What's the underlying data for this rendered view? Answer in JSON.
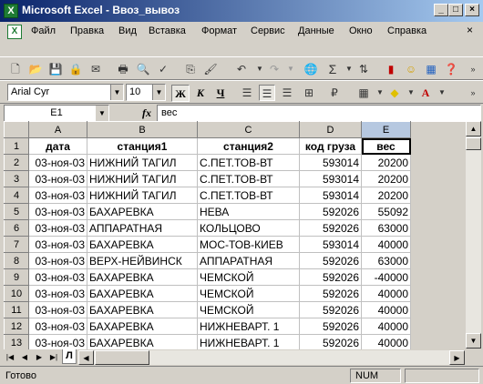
{
  "window": {
    "title": "Microsoft Excel - Ввоз_вывоз"
  },
  "menu": [
    "Файл",
    "Правка",
    "Вид",
    "Вставка",
    "Формат",
    "Сервис",
    "Данные",
    "Окно",
    "Справка"
  ],
  "format_toolbar": {
    "font": "Arial Cyr",
    "size": "10",
    "bold": "Ж",
    "italic": "К",
    "underline": "Ч"
  },
  "formula_bar": {
    "cell_ref": "E1",
    "fx": "fx",
    "content": "вес"
  },
  "sheet": {
    "columns": [
      "A",
      "B",
      "C",
      "D",
      "E"
    ],
    "rows": [
      [
        "1",
        "дата",
        "станция1",
        "станция2",
        "код груза",
        "вес"
      ],
      [
        "2",
        "03-ноя-03",
        "НИЖНИЙ ТАГИЛ",
        "С.ПЕТ.ТОВ-ВТ",
        "593014",
        "20200"
      ],
      [
        "3",
        "03-ноя-03",
        "НИЖНИЙ ТАГИЛ",
        "С.ПЕТ.ТОВ-ВТ",
        "593014",
        "20200"
      ],
      [
        "4",
        "03-ноя-03",
        "НИЖНИЙ ТАГИЛ",
        "С.ПЕТ.ТОВ-ВТ",
        "593014",
        "20200"
      ],
      [
        "5",
        "03-ноя-03",
        "БАХАРЕВКА",
        "НЕВА",
        "592026",
        "55092"
      ],
      [
        "6",
        "03-ноя-03",
        "АППАРАТНАЯ",
        "КОЛЬЦОВО",
        "592026",
        "63000"
      ],
      [
        "7",
        "03-ноя-03",
        "БАХАРЕВКА",
        "МОС-ТОВ-КИЕВ",
        "593014",
        "40000"
      ],
      [
        "8",
        "03-ноя-03",
        "ВЕРХ-НЕЙВИНСК",
        "АППАРАТНАЯ",
        "592026",
        "63000"
      ],
      [
        "9",
        "03-ноя-03",
        "БАХАРЕВКА",
        "ЧЕМСКОЙ",
        "592026",
        "-40000"
      ],
      [
        "10",
        "03-ноя-03",
        "БАХАРЕВКА",
        "ЧЕМСКОЙ",
        "592026",
        "40000"
      ],
      [
        "11",
        "03-ноя-03",
        "БАХАРЕВКА",
        "ЧЕМСКОЙ",
        "592026",
        "40000"
      ],
      [
        "12",
        "03-ноя-03",
        "БАХАРЕВКА",
        "НИЖНЕВАРТ. 1",
        "592026",
        "40000"
      ],
      [
        "13",
        "03-ноя-03",
        "БАХАРЕВКА",
        "НИЖНЕВАРТ. 1",
        "592026",
        "40000"
      ]
    ]
  },
  "sheet_tab": "Л",
  "status": {
    "ready": "Готово",
    "num": "NUM"
  }
}
